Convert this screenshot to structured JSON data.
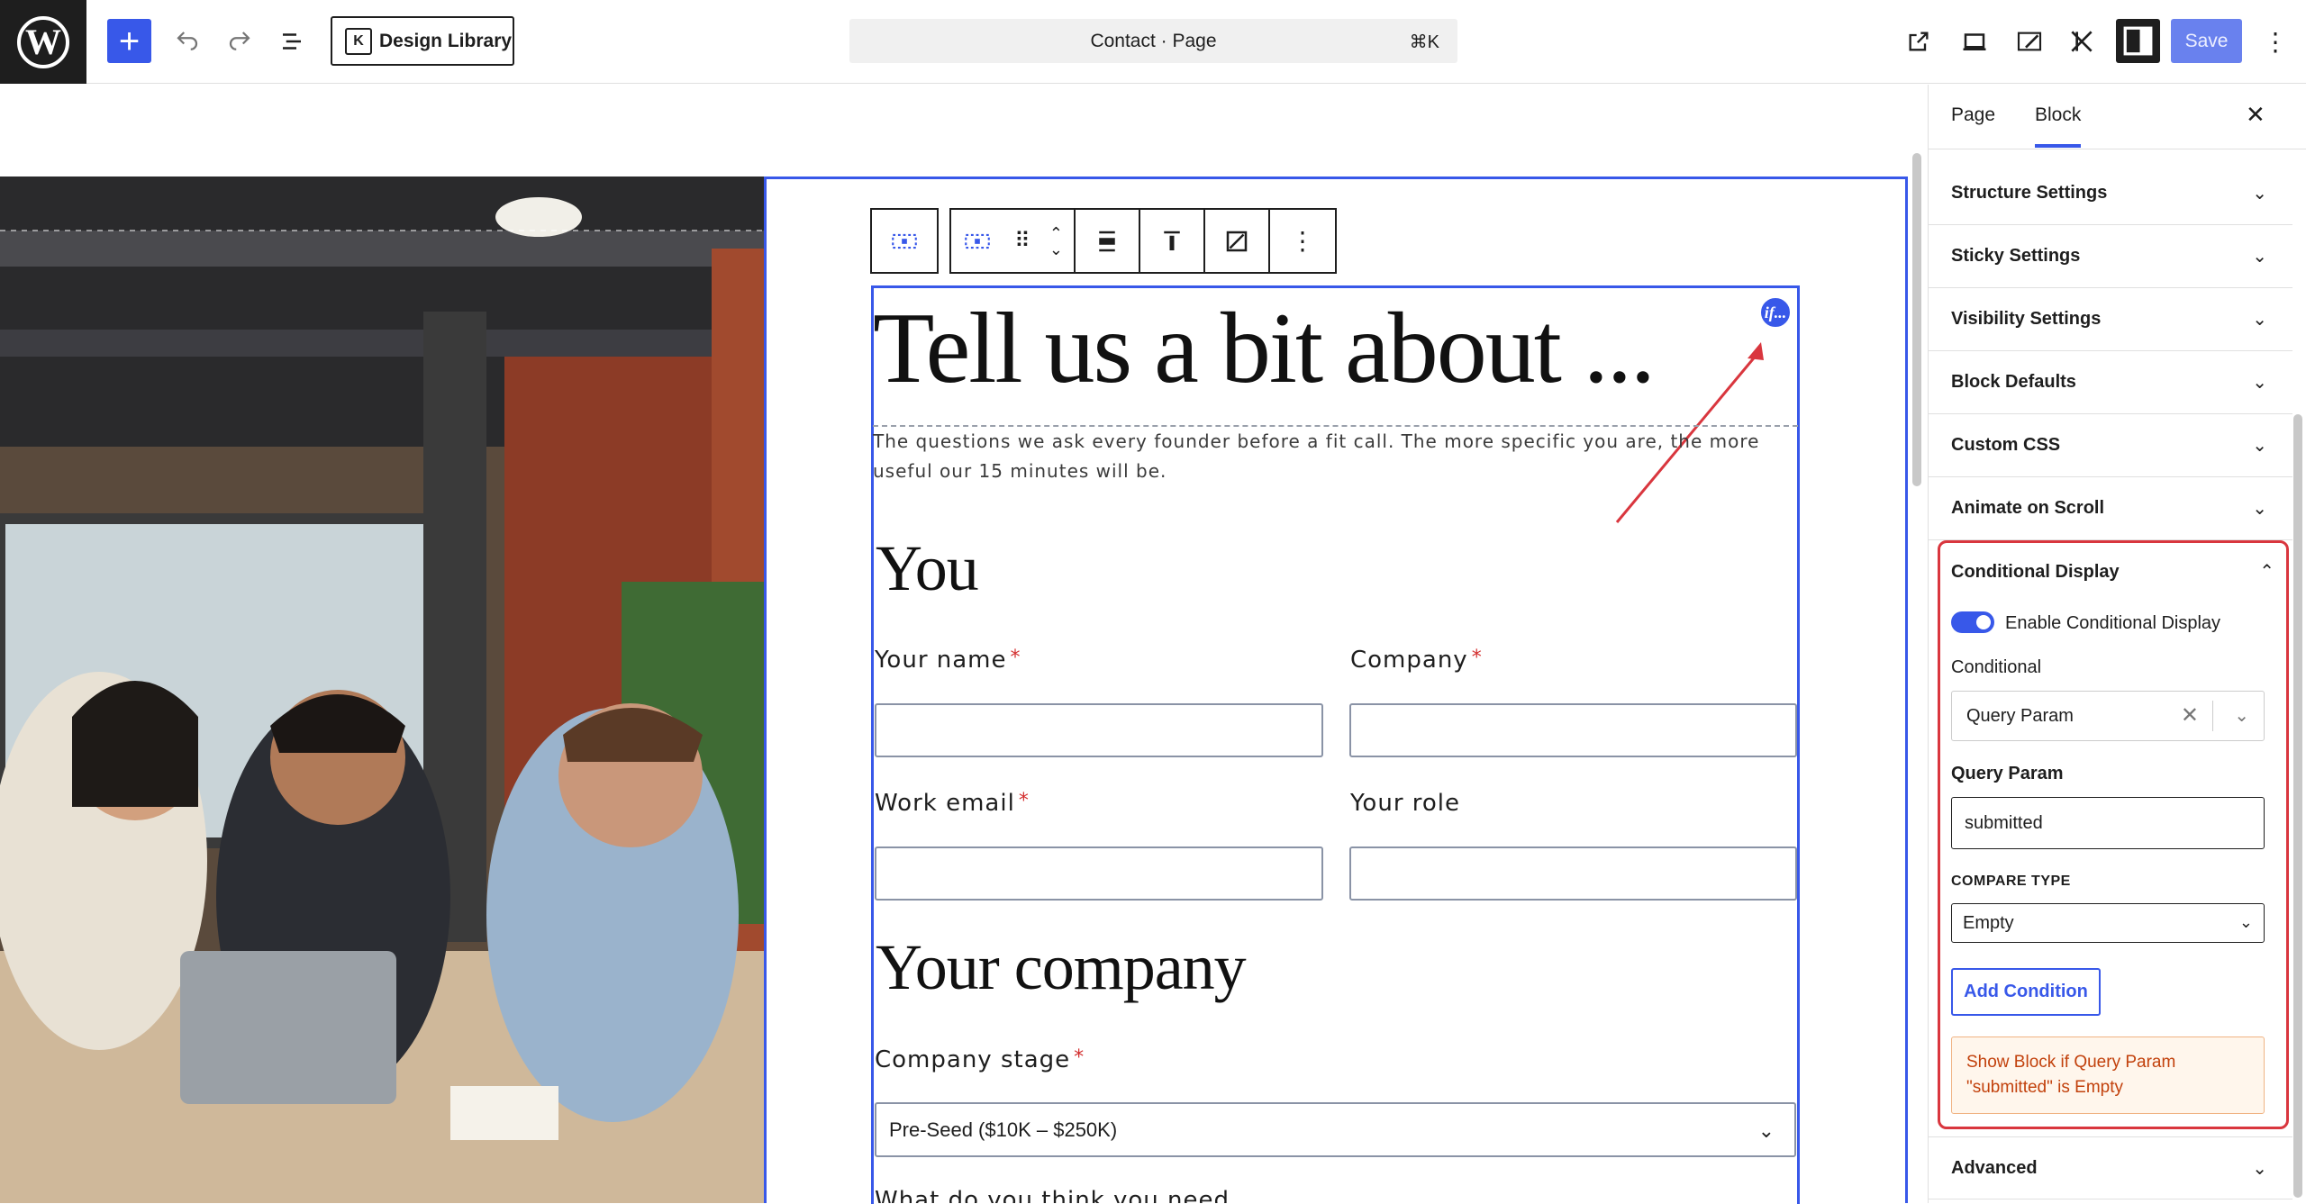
{
  "topbar": {
    "wp_logo": "W",
    "add_label": "+",
    "design_library_label": "Design Library",
    "command_title": "Contact · Page",
    "command_shortcut": "⌘K",
    "save_label": "Save"
  },
  "block_toolbar": {
    "more_label": "⋮"
  },
  "content": {
    "heading": "Tell us a bit about ...",
    "subtext": "The questions we ask every founder before a fit call. The more specific you are, the more useful our 15 minutes will be.",
    "if_badge": "if...",
    "section_you": "You",
    "label_name": "Your name",
    "label_company": "Company",
    "label_email": "Work email",
    "label_role": "Your role",
    "section_company": "Your company",
    "label_stage": "Company stage",
    "stage_value": "Pre-Seed ($10K – $250K)",
    "required_mark": "*",
    "cut_label": "What do you think you need"
  },
  "sidebar": {
    "tab_page": "Page",
    "tab_block": "Block",
    "close": "✕",
    "panels": [
      {
        "label": "Structure Settings"
      },
      {
        "label": "Sticky Settings"
      },
      {
        "label": "Visibility Settings"
      },
      {
        "label": "Block Defaults"
      },
      {
        "label": "Custom CSS"
      },
      {
        "label": "Animate on Scroll"
      }
    ],
    "conditional": {
      "title": "Conditional Display",
      "enable_label": "Enable Conditional Display",
      "enabled": true,
      "conditional_label": "Conditional",
      "conditional_value": "Query Param",
      "query_param_label": "Query Param",
      "query_param_value": "submitted",
      "compare_type_label": "COMPARE TYPE",
      "compare_type_value": "Empty",
      "add_condition_label": "Add Condition",
      "notice": "Show Block if Query Param \"submitted\" is Empty"
    },
    "advanced_label": "Advanced"
  },
  "colors": {
    "accent": "#3858e9",
    "highlight_red": "#d9363e",
    "notice_text": "#c2410c"
  }
}
